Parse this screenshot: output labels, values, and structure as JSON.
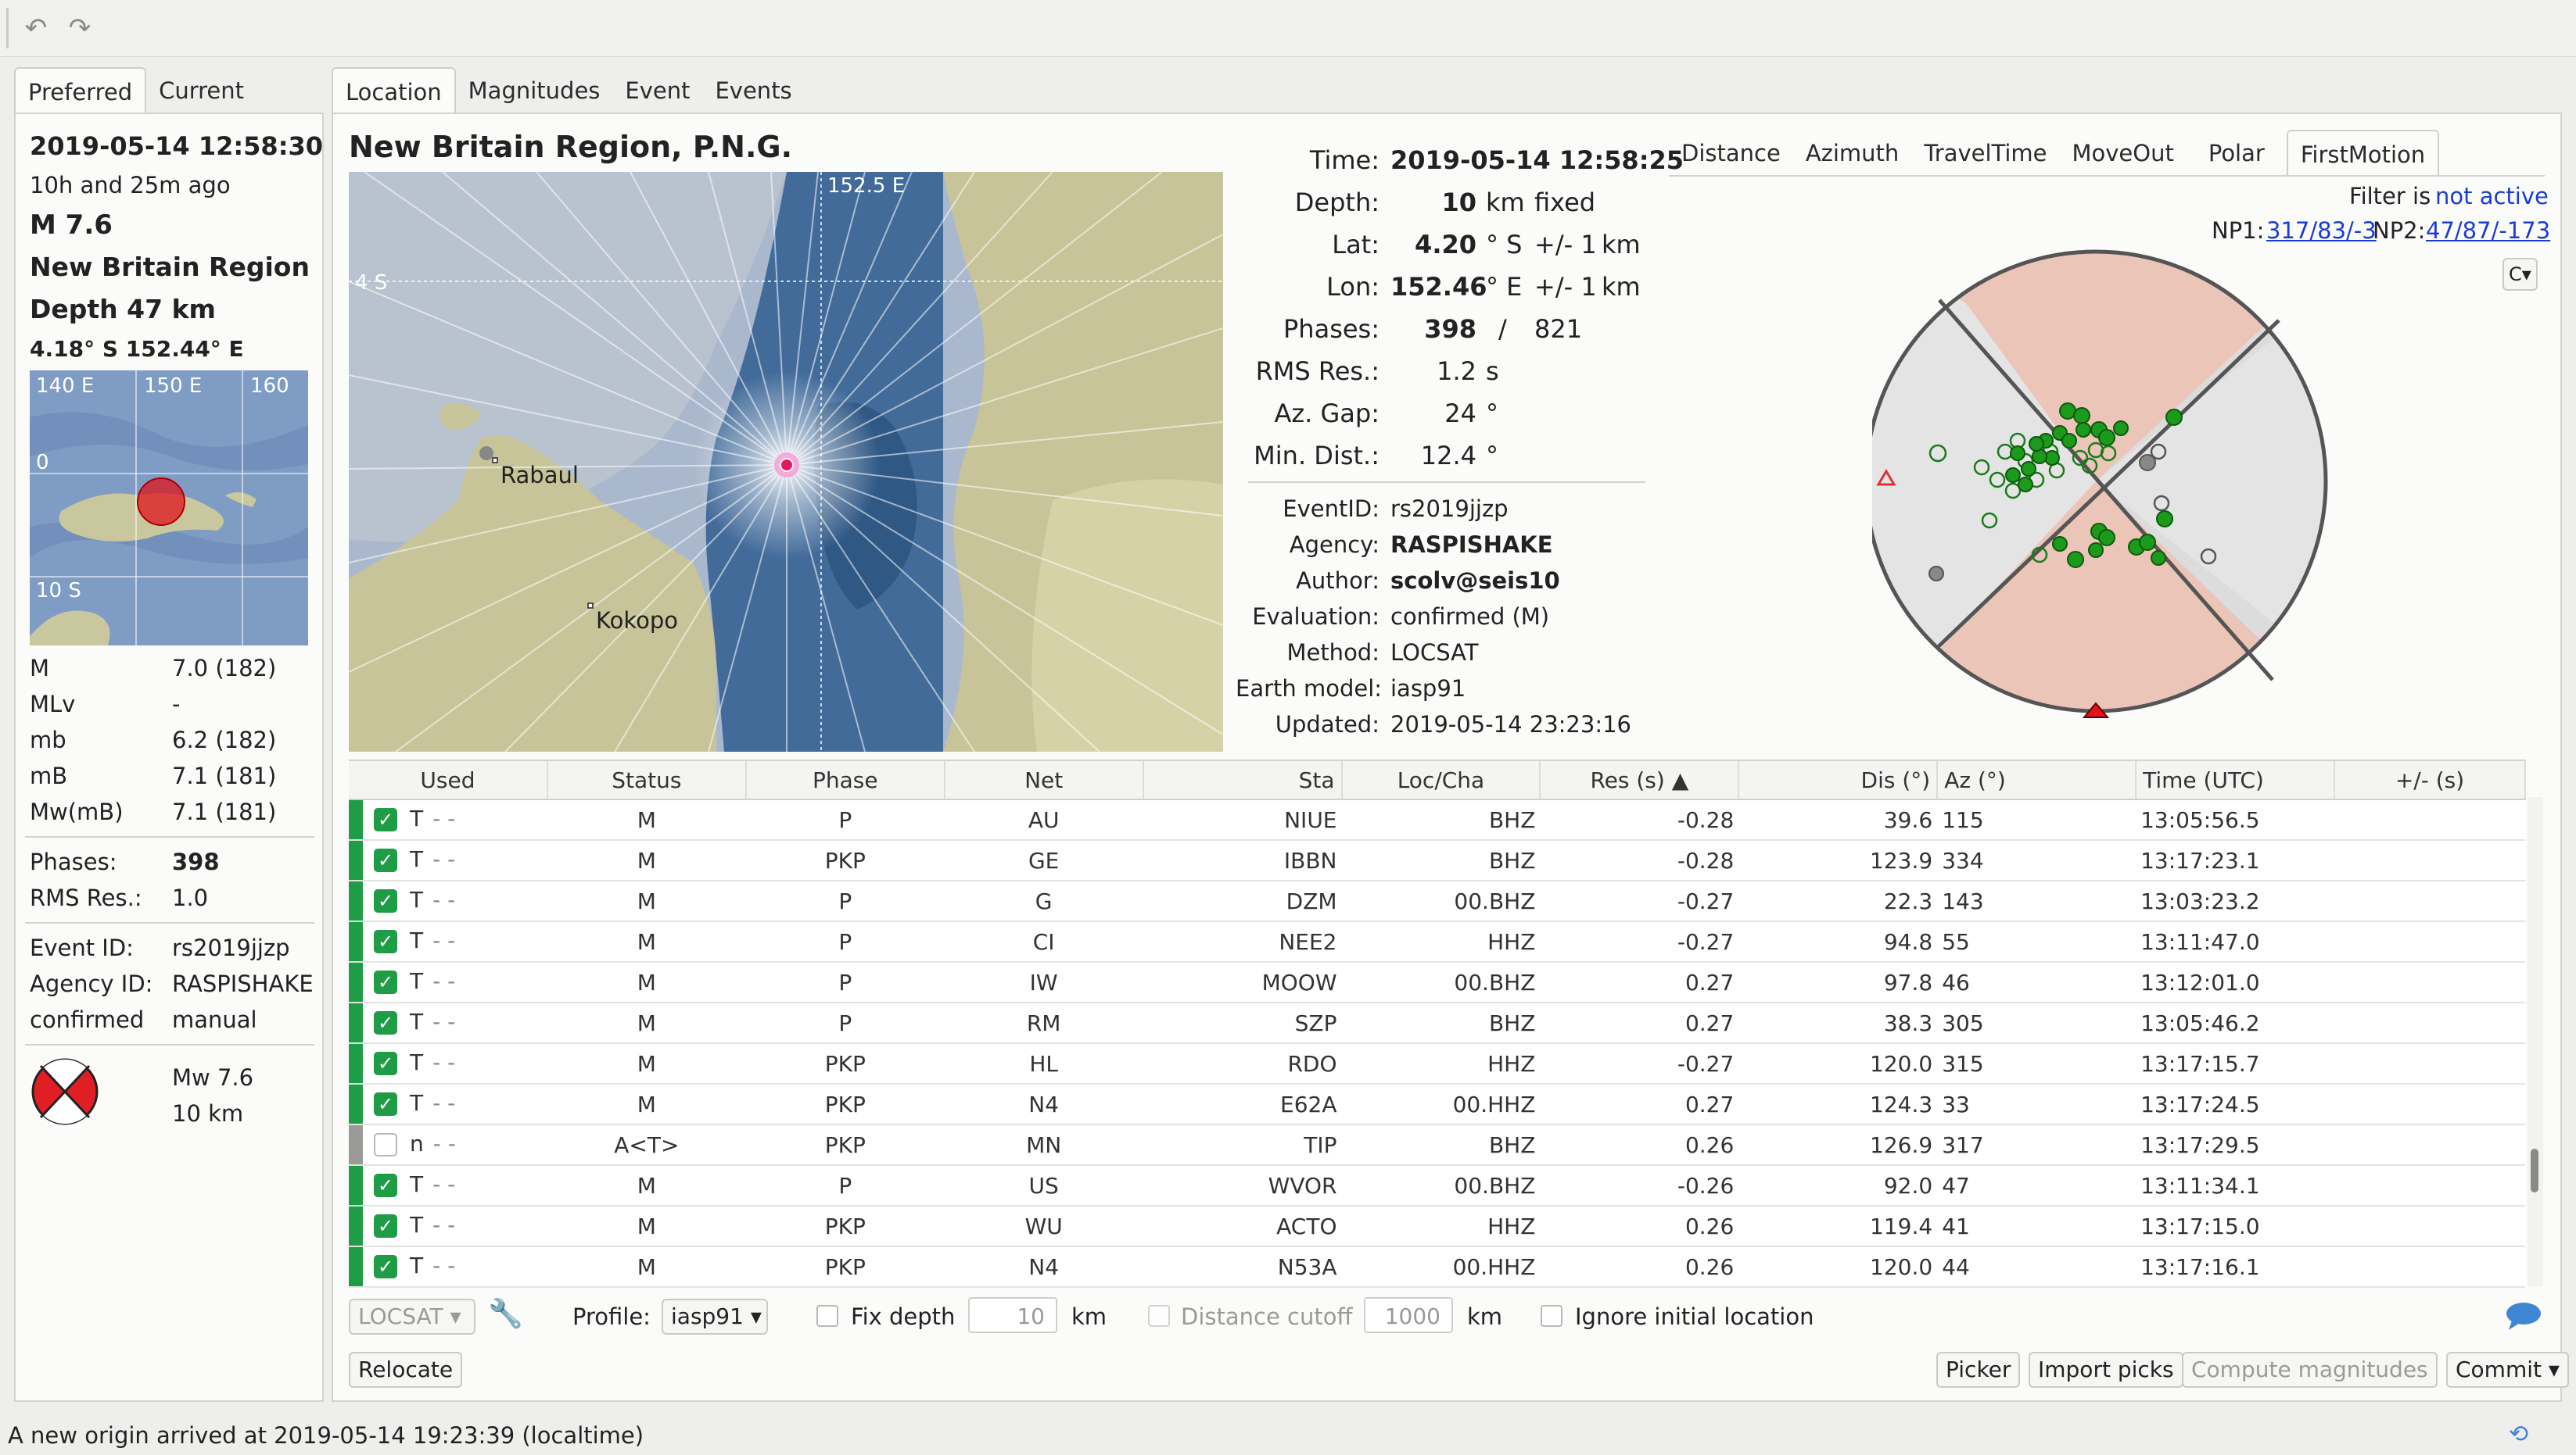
{
  "toolbar": {
    "undo_icon": "undo-icon",
    "redo_icon": "redo-icon"
  },
  "left": {
    "tabs": [
      "Preferred",
      "Current"
    ],
    "time": "2019-05-14 12:58:30",
    "ago": "10h and 25m ago",
    "mag": "M 7.6",
    "region": "New Britain Region, P.N.G.",
    "depth": "Depth 47 km",
    "latlon": "4.18° S   152.44° E",
    "map_labels": [
      "140 E",
      "150 E",
      "160",
      "0",
      "10 S"
    ],
    "mags": [
      {
        "type": "M",
        "value": "7.0 (182)"
      },
      {
        "type": "MLv",
        "value": "-"
      },
      {
        "type": "mb",
        "value": "6.2 (182)"
      },
      {
        "type": "mB",
        "value": "7.1 (181)"
      },
      {
        "type": "Mw(mB)",
        "value": "7.1 (181)"
      }
    ],
    "phases_label": "Phases:",
    "phases": "398",
    "rms_label": "RMS Res.:",
    "rms": "1.0",
    "eventid_label": "Event ID:",
    "eventid": "rs2019jjzp",
    "agency_label": "Agency ID:",
    "agency": "RASPISHAKE",
    "status_label": "confirmed",
    "status": "manual",
    "fm_mag": "Mw 7.6",
    "fm_depth": "10 km"
  },
  "main_tabs": [
    "Location",
    "Magnitudes",
    "Event",
    "Events"
  ],
  "region_title": "New Britain Region, P.N.G.",
  "map": {
    "lon_label": "152.5 E",
    "lat_label": "4 S",
    "city1": "Rabaul",
    "city2": "Kokopo"
  },
  "origin": {
    "time_label": "Time:",
    "time": "2019-05-14 12:58:25",
    "depth_label": "Depth:",
    "depth": "10",
    "depth_unit": "km",
    "depth_type": "fixed",
    "lat_label": "Lat:",
    "lat": "4.20",
    "lat_unit": "° S",
    "lat_err": "+/- 1",
    "lat_err_unit": "km",
    "lon_label": "Lon:",
    "lon": "152.46",
    "lon_unit": "° E",
    "lon_err": "+/- 1",
    "lon_err_unit": "km",
    "phases_label": "Phases:",
    "phases_used": "398",
    "phases_slash": "/",
    "phases_total": "821",
    "rms_label": "RMS Res.:",
    "rms": "1.2",
    "rms_unit": "s",
    "gap_label": "Az. Gap:",
    "gap": "24",
    "gap_unit": "°",
    "mindist_label": "Min. Dist.:",
    "mindist": "12.4",
    "mindist_unit": "°",
    "eventid_label": "EventID:",
    "eventid": "rs2019jjzp",
    "agency_label": "Agency:",
    "agency": "RASPISHAKE",
    "author_label": "Author:",
    "author": "scolv@seis10",
    "evaluation_label": "Evaluation:",
    "evaluation": "confirmed (M)",
    "method_label": "Method:",
    "method": "LOCSAT",
    "earthmodel_label": "Earth model:",
    "earthmodel": "iasp91",
    "updated_label": "Updated:",
    "updated": "2019-05-14 23:23:16"
  },
  "plot_tabs": [
    "Distance",
    "Azimuth",
    "TravelTime",
    "MoveOut",
    "Polar",
    "FirstMotion"
  ],
  "filter": {
    "label": "Filter is",
    "state": "not active"
  },
  "np": {
    "np1_label": "NP1:",
    "np1": "317/83/-3",
    "np2_label": "NP2:",
    "np2": "47/87/-173"
  },
  "plot_menu": "C▾",
  "table": {
    "headers": [
      "Used",
      "Status",
      "Phase",
      "Net",
      "Sta",
      "Loc/Cha",
      "Res (s) ▲",
      "Dis (°)",
      "Az (°)",
      "Time (UTC)",
      "+/- (s)"
    ],
    "rows": [
      {
        "used": true,
        "flag": "T",
        "status": "M",
        "phase": "P",
        "net": "AU",
        "sta": "NIUE",
        "cha": "BHZ",
        "res": "-0.28",
        "dis": "39.6",
        "az": "115",
        "time": "13:05:56.5"
      },
      {
        "used": true,
        "flag": "T",
        "status": "M",
        "phase": "PKP",
        "net": "GE",
        "sta": "IBBN",
        "cha": "BHZ",
        "res": "-0.28",
        "dis": "123.9",
        "az": "334",
        "time": "13:17:23.1"
      },
      {
        "used": true,
        "flag": "T",
        "status": "M",
        "phase": "P",
        "net": "G",
        "sta": "DZM",
        "cha": "00.BHZ",
        "res": "-0.27",
        "dis": "22.3",
        "az": "143",
        "time": "13:03:23.2"
      },
      {
        "used": true,
        "flag": "T",
        "status": "M",
        "phase": "P",
        "net": "CI",
        "sta": "NEE2",
        "cha": "HHZ",
        "res": "-0.27",
        "dis": "94.8",
        "az": "55",
        "time": "13:11:47.0"
      },
      {
        "used": true,
        "flag": "T",
        "status": "M",
        "phase": "P",
        "net": "IW",
        "sta": "MOOW",
        "cha": "00.BHZ",
        "res": "0.27",
        "dis": "97.8",
        "az": "46",
        "time": "13:12:01.0"
      },
      {
        "used": true,
        "flag": "T",
        "status": "M",
        "phase": "P",
        "net": "RM",
        "sta": "SZP",
        "cha": "BHZ",
        "res": "0.27",
        "dis": "38.3",
        "az": "305",
        "time": "13:05:46.2"
      },
      {
        "used": true,
        "flag": "T",
        "status": "M",
        "phase": "PKP",
        "net": "HL",
        "sta": "RDO",
        "cha": "HHZ",
        "res": "-0.27",
        "dis": "120.0",
        "az": "315",
        "time": "13:17:15.7"
      },
      {
        "used": true,
        "flag": "T",
        "status": "M",
        "phase": "PKP",
        "net": "N4",
        "sta": "E62A",
        "cha": "00.HHZ",
        "res": "0.27",
        "dis": "124.3",
        "az": "33",
        "time": "13:17:24.5"
      },
      {
        "used": false,
        "flag": "n",
        "status": "A<T>",
        "phase": "PKP",
        "net": "MN",
        "sta": "TIP",
        "cha": "BHZ",
        "res": "0.26",
        "dis": "126.9",
        "az": "317",
        "time": "13:17:29.5"
      },
      {
        "used": true,
        "flag": "T",
        "status": "M",
        "phase": "P",
        "net": "US",
        "sta": "WVOR",
        "cha": "00.BHZ",
        "res": "-0.26",
        "dis": "92.0",
        "az": "47",
        "time": "13:11:34.1"
      },
      {
        "used": true,
        "flag": "T",
        "status": "M",
        "phase": "PKP",
        "net": "WU",
        "sta": "ACTO",
        "cha": "HHZ",
        "res": "0.26",
        "dis": "119.4",
        "az": "41",
        "time": "13:17:15.0"
      },
      {
        "used": true,
        "flag": "T",
        "status": "M",
        "phase": "PKP",
        "net": "N4",
        "sta": "N53A",
        "cha": "00.HHZ",
        "res": "0.26",
        "dis": "120.0",
        "az": "44",
        "time": "13:17:16.1"
      }
    ]
  },
  "controls": {
    "locator": "LOCSAT",
    "profile_label": "Profile:",
    "profile": "iasp91",
    "fix_depth": "Fix depth",
    "depth_value": "10",
    "depth_unit": "km",
    "dist_cutoff": "Distance cutoff",
    "dist_value": "1000",
    "dist_unit": "km",
    "ignore_initial": "Ignore initial location",
    "relocate": "Relocate",
    "picker": "Picker",
    "import_picks": "Import picks",
    "compute_mags": "Compute magnitudes",
    "commit": "Commit"
  },
  "status_message": "A new origin arrived at 2019-05-14 19:23:39 (localtime)"
}
